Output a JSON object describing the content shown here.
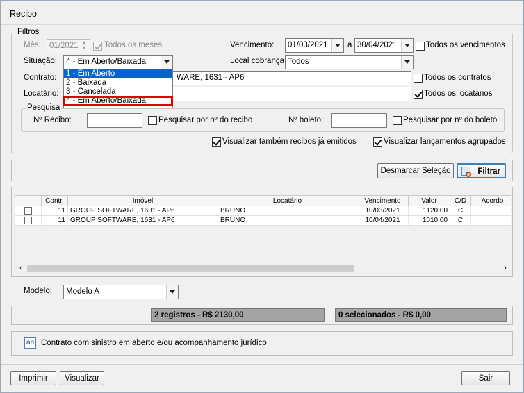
{
  "window": {
    "title": "Recibo"
  },
  "filters": {
    "legend": "Filtros",
    "mes": {
      "label": "Mês:",
      "value": "01/2021",
      "todos_label": "Todos os meses",
      "todos_checked": true
    },
    "vencimento": {
      "label": "Vencimento:",
      "from": "01/03/2021",
      "separator": "a",
      "to": "30/04/2021",
      "todos_label": "Todos os vencimentos",
      "todos_checked": false
    },
    "situacao": {
      "label": "Situação:",
      "value": "4 - Em Aberto/Baixada",
      "options": [
        "1 - Em Aberto",
        "2 - Baixada",
        "3 - Cancelada",
        "4 - Em Aberto/Baixada"
      ]
    },
    "local_cobranca": {
      "label": "Local cobrança:",
      "value": "Todos"
    },
    "contrato": {
      "label": "Contrato:",
      "value": "WARE, 1631 - AP6",
      "todos_label": "Todos os contratos",
      "todos_checked": false
    },
    "locatario": {
      "label": "Locatário:",
      "value": "",
      "todos_label": "Todos os locatários",
      "todos_checked": true
    },
    "pesquisa": {
      "legend": "Pesquisa",
      "recibo_label": "Nº Recibo:",
      "recibo_value": "",
      "recibo_check_label": "Pesquisar por nº do recibo",
      "recibo_checked": false,
      "boleto_label": "Nº boleto:",
      "boleto_value": "",
      "boleto_check_label": "Pesquisar por nº do boleto",
      "boleto_checked": false
    },
    "visualizar_emitidos": {
      "label": "Visualizar também recibos já emitidos",
      "checked": true
    },
    "visualizar_agrupados": {
      "label": "Visualizar lançamentos agrupados",
      "checked": true
    }
  },
  "actions": {
    "desmarcar": "Desmarcar Seleção",
    "filtrar": "Filtrar"
  },
  "grid": {
    "columns": [
      "",
      "Contr.",
      "Imóvel",
      "Locatário",
      "Vencimento",
      "Valor",
      "C/D",
      "Acordo"
    ],
    "rows": [
      {
        "checked": false,
        "contr": "11",
        "imovel": "GROUP SOFTWARE, 1631 - AP6",
        "locatario": "BRUNO",
        "vencimento": "10/03/2021",
        "valor": "1120,00",
        "cd": "C",
        "acordo": ""
      },
      {
        "checked": false,
        "contr": "11",
        "imovel": "GROUP SOFTWARE, 1631 - AP6",
        "locatario": "BRUNO",
        "vencimento": "10/04/2021",
        "valor": "1010,00",
        "cd": "C",
        "acordo": ""
      }
    ]
  },
  "modelo": {
    "label": "Modelo:",
    "value": "Modelo A"
  },
  "summary": {
    "registros": "2 registros - R$ 2130,00",
    "selecionados": "0 selecionados - R$ 0,00"
  },
  "legenda": {
    "badge": "ab",
    "text": "Contrato com sinistro em aberto e/ou acompanhamento jurídico"
  },
  "footer": {
    "imprimir": "Imprimir",
    "visualizar": "Visualizar",
    "sair": "Sair"
  },
  "colors": {
    "selection": "#0a64c8",
    "highlight_border": "#e00000",
    "status_bg": "#a4a4a4"
  }
}
